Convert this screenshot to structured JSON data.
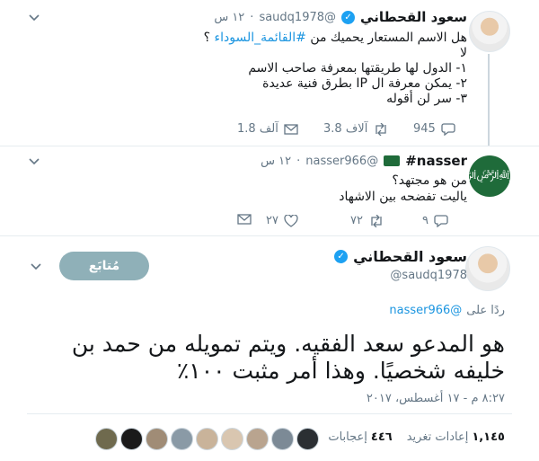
{
  "tweet1": {
    "name": "سعود القحطاني",
    "handle": "@saudq1978",
    "time": "١٢ س",
    "question": "هل الاسم المستعار يحميك من",
    "hashtag": "#القائمة_السوداء",
    "qmark": "؟",
    "lines": [
      "لا",
      "١- الدول لها طريقتها بمعرفة صاحب الاسم",
      "٢- يمكن معرفة ال IP بطرق فنية عديدة",
      "٣- سر لن أقوله"
    ],
    "replies": "945",
    "retweets": "3.8 آلاف",
    "likes": "1.8 آلف"
  },
  "tweet2": {
    "name": "nasser#",
    "handle": "@nasser966",
    "time": "١٢ س",
    "lines": [
      "من هو مجتهد؟",
      "ياليت تفضحه بين الاشهاد"
    ],
    "replies": "٩",
    "retweets": "٧٢",
    "likes": "٢٧"
  },
  "tweet3": {
    "name": "سعود القحطاني",
    "handle": "@saudq1978",
    "follow_label": "مُتابَع",
    "reply_prefix": "ردًا على",
    "reply_to": "@nasser966",
    "text_line1": "هو المدعو سعد الفقيه.  ويتم تمويله من حمد بن",
    "text_line2": "خليفه شخصيًا.  وهذا أمر مثبت ١٠٠٪",
    "timestamp": "٨:٢٧ م - ١٧ أغسطس، ٢٠١٧",
    "retweets_count": "١,١٤٥",
    "retweets_label": "إعادات تغريد",
    "likes_count": "٤٤٦",
    "likes_label": "إعجابات"
  },
  "colors": {
    "link": "#1b95e0",
    "muted": "#657786",
    "follow_button": "#8fb0b8",
    "verified": "#1da1f2"
  }
}
